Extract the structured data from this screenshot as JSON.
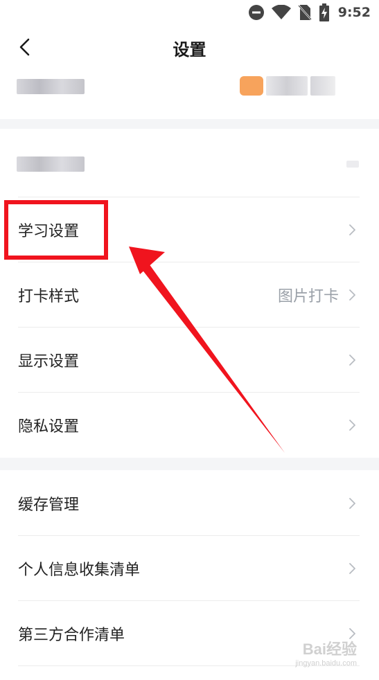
{
  "status_bar": {
    "time": "9:52",
    "icons": [
      "dnd-icon",
      "wifi-icon",
      "no-sim-icon",
      "battery-charging-icon"
    ]
  },
  "header": {
    "title": "设置",
    "back_icon": "chevron-left-icon"
  },
  "settings": {
    "group2": [
      {
        "label": "学习设置",
        "value": ""
      },
      {
        "label": "打卡样式",
        "value": "图片打卡"
      },
      {
        "label": "显示设置",
        "value": ""
      },
      {
        "label": "隐私设置",
        "value": ""
      }
    ],
    "group3": [
      {
        "label": "缓存管理",
        "value": ""
      },
      {
        "label": "个人信息收集清单",
        "value": ""
      },
      {
        "label": "第三方合作清单",
        "value": ""
      }
    ]
  },
  "annotation": {
    "box_color": "#f0141e",
    "arrow_color": "#f0141e"
  },
  "watermark": {
    "main": "Bai经验",
    "sub": "jingyan.baidu.com"
  }
}
